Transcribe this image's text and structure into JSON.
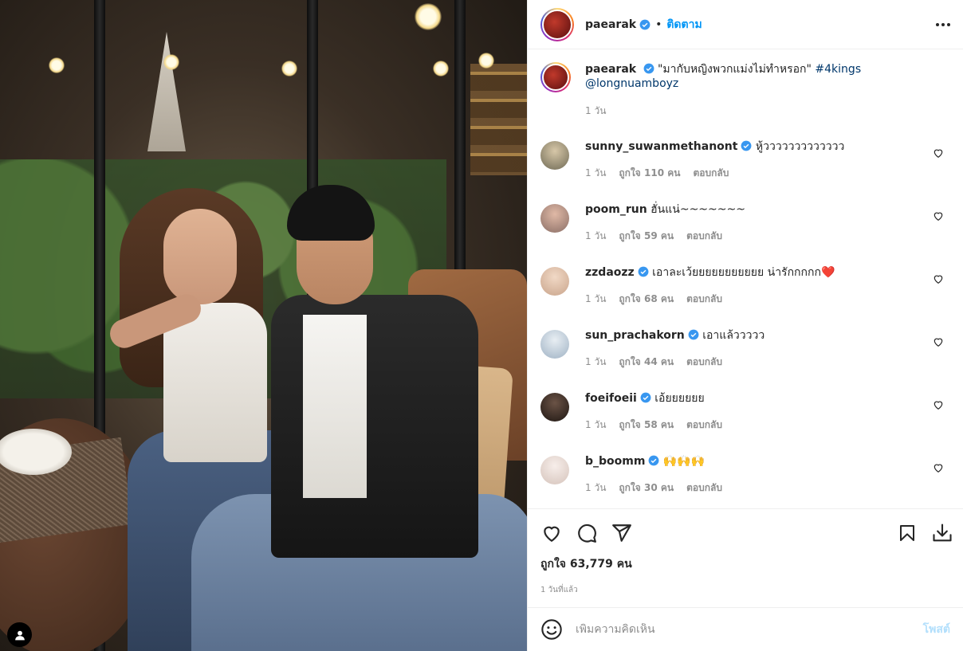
{
  "post": {
    "username": "paearak",
    "follow_label": "ติดตาม",
    "dot": "•",
    "caption_username": "paearak",
    "caption_text": "\"มากับหญิงพวกแม่งไม่ทำหรอก\"",
    "caption_hashtag": "#4kings",
    "caption_mention": "@longnuamboyz",
    "caption_time": "1 วัน",
    "likes": "ถูกใจ 63,779 คน",
    "posted_ago": "1 วันที่แล้ว"
  },
  "comments": [
    {
      "username": "sunny_suwanmethanont",
      "verified": true,
      "text": "หู้ววววววววววววว",
      "time": "1 วัน",
      "likes": "ถูกใจ 110 คน",
      "reply": "ตอบกลับ",
      "avatar_color": "#6f6a55"
    },
    {
      "username": "poom_run",
      "verified": false,
      "text": "ฮั่นแน่~~~~~~~",
      "time": "1 วัน",
      "likes": "ถูกใจ 59 คน",
      "reply": "ตอบกลับ",
      "avatar_color": "#8a6e66"
    },
    {
      "username": "zzdaozz",
      "verified": true,
      "text": "เอาละเว้ยยยยยยยยยยย น่ารักกกกก❤️",
      "time": "1 วัน",
      "likes": "ถูกใจ 68 คน",
      "reply": "ตอบกลับ",
      "avatar_color": "#c9a48b"
    },
    {
      "username": "sun_prachakorn",
      "verified": true,
      "text": "เอาแล้ววววว",
      "time": "1 วัน",
      "likes": "ถูกใจ 44 คน",
      "reply": "ตอบกลับ",
      "avatar_color": "#9fb2c4"
    },
    {
      "username": "foeifoeii",
      "verified": true,
      "text": "เอ้ยยยยยย",
      "time": "1 วัน",
      "likes": "ถูกใจ 58 คน",
      "reply": "ตอบกลับ",
      "avatar_color": "#3a2a22"
    },
    {
      "username": "b_boomm",
      "verified": true,
      "text": "🙌🙌🙌",
      "time": "1 วัน",
      "likes": "ถูกใจ 30 คน",
      "reply": "ตอบกลับ",
      "avatar_color": "#e9dcd6"
    }
  ],
  "comment_box": {
    "placeholder": "เพิ่มความคิดเห็น",
    "post_label": "โพสต์"
  },
  "icons": {
    "like": "heart-icon",
    "comment": "comment-icon",
    "share": "share-icon",
    "save": "bookmark-icon",
    "download": "download-icon",
    "emoji": "emoji-icon",
    "more": "more-options-icon",
    "tag": "user-tag-icon"
  },
  "colors": {
    "accent": "#0095f6",
    "verified": "#3897f0",
    "link": "#00376b",
    "muted": "#8e8e8e",
    "post_disabled": "#b2dffc"
  }
}
